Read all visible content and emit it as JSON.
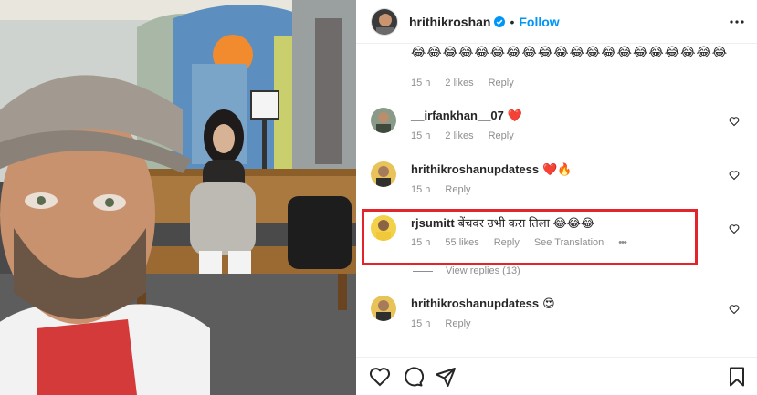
{
  "header": {
    "username": "hrithikroshan",
    "follow_label": "Follow",
    "separator": "•"
  },
  "top_comment": {
    "emojis": "😂😂😂😂😂😂😂😂😂😂😂😂😂😂😂😂😂😂😂😂",
    "time": "15 h",
    "likes": "2 likes",
    "reply_label": "Reply"
  },
  "comments": [
    {
      "user": "__irfankhan__07",
      "text": "❤️",
      "time": "15 h",
      "likes": "2 likes",
      "reply_label": "Reply"
    },
    {
      "user": "hrithikroshanupdatess",
      "text": "❤️🔥",
      "time": "15 h",
      "likes": "",
      "reply_label": "Reply"
    },
    {
      "user": "rjsumitt",
      "text": "बेंचवर उभी करा तिला 😂😂😂",
      "time": "15 h",
      "likes": "55 likes",
      "reply_label": "Reply",
      "translation_label": "See Translation",
      "more": "•••"
    },
    {
      "user": "hrithikroshanupdatess",
      "text": "😍",
      "time": "15 h",
      "likes": "",
      "reply_label": "Reply"
    }
  ],
  "view_replies": "View replies (13)",
  "colors": {
    "accent": "#0095f6",
    "highlight": "#e3242b",
    "heart": "#ed4956",
    "muted": "#8e8e8e"
  },
  "icons": [
    "verified-badge-icon",
    "more-options-icon",
    "heart-icon",
    "comment-icon",
    "share-icon",
    "bookmark-icon"
  ]
}
